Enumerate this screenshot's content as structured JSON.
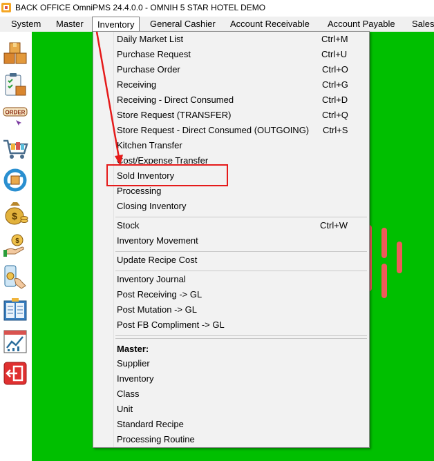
{
  "window": {
    "title": "BACK OFFICE OmniPMS 24.4.0.0 - OMNIH 5 STAR HOTEL DEMO"
  },
  "menubar": [
    "System",
    "Master",
    "Inventory",
    "General Cashier",
    "Account Receivable",
    "Account Payable",
    "Sales"
  ],
  "inventory_menu": {
    "items": [
      {
        "label": "Daily Market List",
        "shortcut": "Ctrl+M"
      },
      {
        "label": "Purchase Request",
        "shortcut": "Ctrl+U"
      },
      {
        "label": "Purchase Order",
        "shortcut": "Ctrl+O"
      },
      {
        "label": "Receiving",
        "shortcut": "Ctrl+G"
      },
      {
        "label": "Receiving - Direct Consumed",
        "shortcut": "Ctrl+D"
      },
      {
        "label": "Store Request (TRANSFER)",
        "shortcut": "Ctrl+Q"
      },
      {
        "label": "Store Request - Direct Consumed (OUTGOING)",
        "shortcut": "Ctrl+S"
      },
      {
        "label": "Kitchen Transfer",
        "shortcut": ""
      },
      {
        "label": "Cost/Expense Transfer",
        "shortcut": ""
      },
      {
        "label": "Sold Inventory",
        "shortcut": ""
      },
      {
        "label": "Processing",
        "shortcut": ""
      },
      {
        "label": "Closing Inventory",
        "shortcut": ""
      },
      {
        "label": "Stock",
        "shortcut": "Ctrl+W"
      },
      {
        "label": "Inventory Movement",
        "shortcut": ""
      },
      {
        "label": "Update Recipe Cost",
        "shortcut": ""
      },
      {
        "label": "Inventory Journal",
        "shortcut": ""
      },
      {
        "label": "Post Receiving -> GL",
        "shortcut": ""
      },
      {
        "label": "Post Mutation -> GL",
        "shortcut": ""
      },
      {
        "label": "Post FB Compliment -> GL",
        "shortcut": ""
      },
      {
        "label": "Master:",
        "shortcut": ""
      },
      {
        "label": "Supplier",
        "shortcut": ""
      },
      {
        "label": "Inventory",
        "shortcut": ""
      },
      {
        "label": "Class",
        "shortcut": ""
      },
      {
        "label": "Unit",
        "shortcut": ""
      },
      {
        "label": "Standard Recipe",
        "shortcut": ""
      },
      {
        "label": "Processing Routine",
        "shortcut": ""
      }
    ],
    "highlighted_item": "Sold Inventory"
  },
  "toolbar_icons": [
    "inventory-boxes-icon",
    "checklist-clipboard-icon",
    "order-icon",
    "shopping-cart-icon",
    "refresh-cycle-icon",
    "money-bag-icon",
    "hand-money-icon",
    "mobile-payment-icon",
    "book-report-icon",
    "chart-report-icon",
    "exit-icon"
  ],
  "colors": {
    "desktop": "#00bf00",
    "annotation": "#e51a1a",
    "bars": "#ef5a5a"
  }
}
